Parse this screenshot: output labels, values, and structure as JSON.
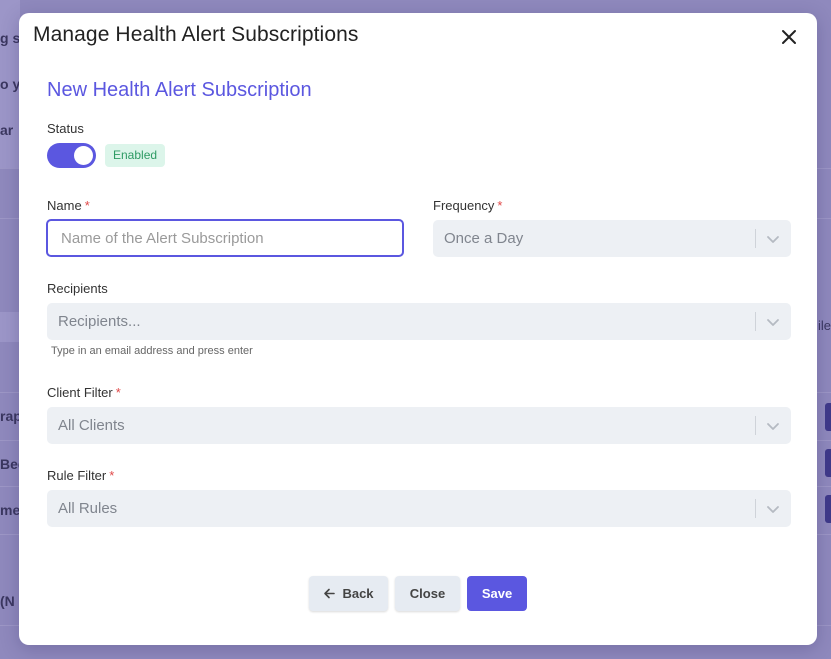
{
  "background": {
    "rows": [
      "g s",
      "o yo",
      "ar",
      "rap",
      "Bed",
      "me",
      "(N"
    ],
    "right_text": "ile"
  },
  "modal": {
    "title": "Manage Health Alert Subscriptions",
    "close_icon": "close-icon"
  },
  "form": {
    "section_title": "New Health Alert Subscription",
    "status": {
      "label": "Status",
      "enabled": true,
      "badge": "Enabled"
    },
    "name": {
      "label": "Name",
      "required_mark": "*",
      "value": "",
      "placeholder": "Name of the Alert Subscription"
    },
    "frequency": {
      "label": "Frequency",
      "required_mark": "*",
      "value": "Once a Day"
    },
    "recipients": {
      "label": "Recipients",
      "placeholder": "Recipients...",
      "hint": "Type in an email address and press enter"
    },
    "client_filter": {
      "label": "Client Filter",
      "required_mark": "*",
      "value": "All Clients"
    },
    "rule_filter": {
      "label": "Rule Filter",
      "required_mark": "*",
      "value": "All Rules"
    }
  },
  "footer": {
    "back_label": "Back",
    "close_label": "Close",
    "save_label": "Save"
  },
  "colors": {
    "accent": "#5b57e0",
    "badge_bg": "#dcf5ea",
    "badge_text": "#2e9b64",
    "required": "#e04848",
    "select_bg": "#edf0f4"
  }
}
